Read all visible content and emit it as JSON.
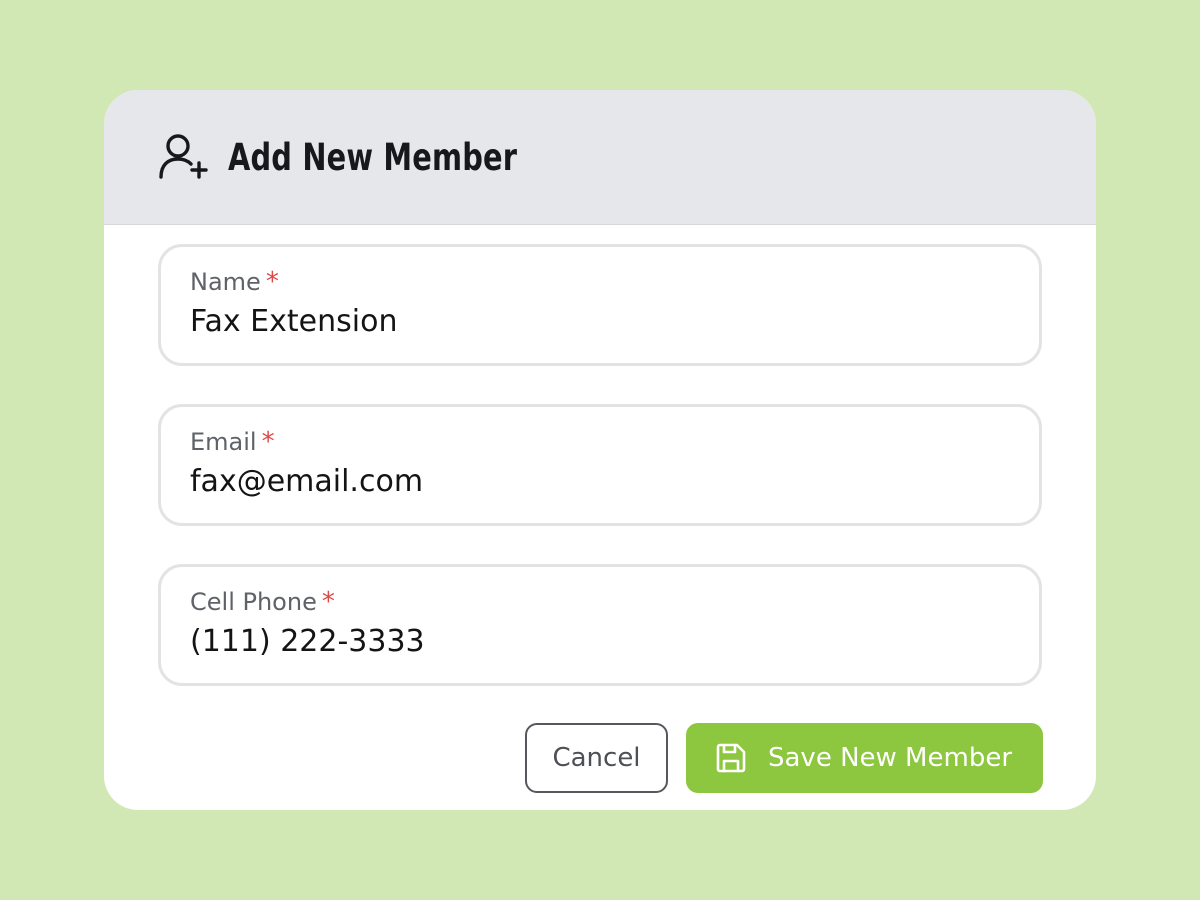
{
  "dialog": {
    "title": "Add New Member",
    "header_icon": "user-plus-icon"
  },
  "form": {
    "fields": [
      {
        "label": "Name",
        "required_mark": "*",
        "value": "Fax Extension"
      },
      {
        "label": "Email",
        "required_mark": "*",
        "value": "fax@email.com"
      },
      {
        "label": "Cell Phone",
        "required_mark": "*",
        "value": "(111) 222-3333"
      }
    ]
  },
  "actions": {
    "cancel_label": "Cancel",
    "save_label": "Save New Member",
    "save_icon": "save-icon"
  },
  "colors": {
    "background": "#d2e8b4",
    "header_background": "#e6e7ea",
    "accent": "#8dc63f",
    "required": "#e04848"
  }
}
